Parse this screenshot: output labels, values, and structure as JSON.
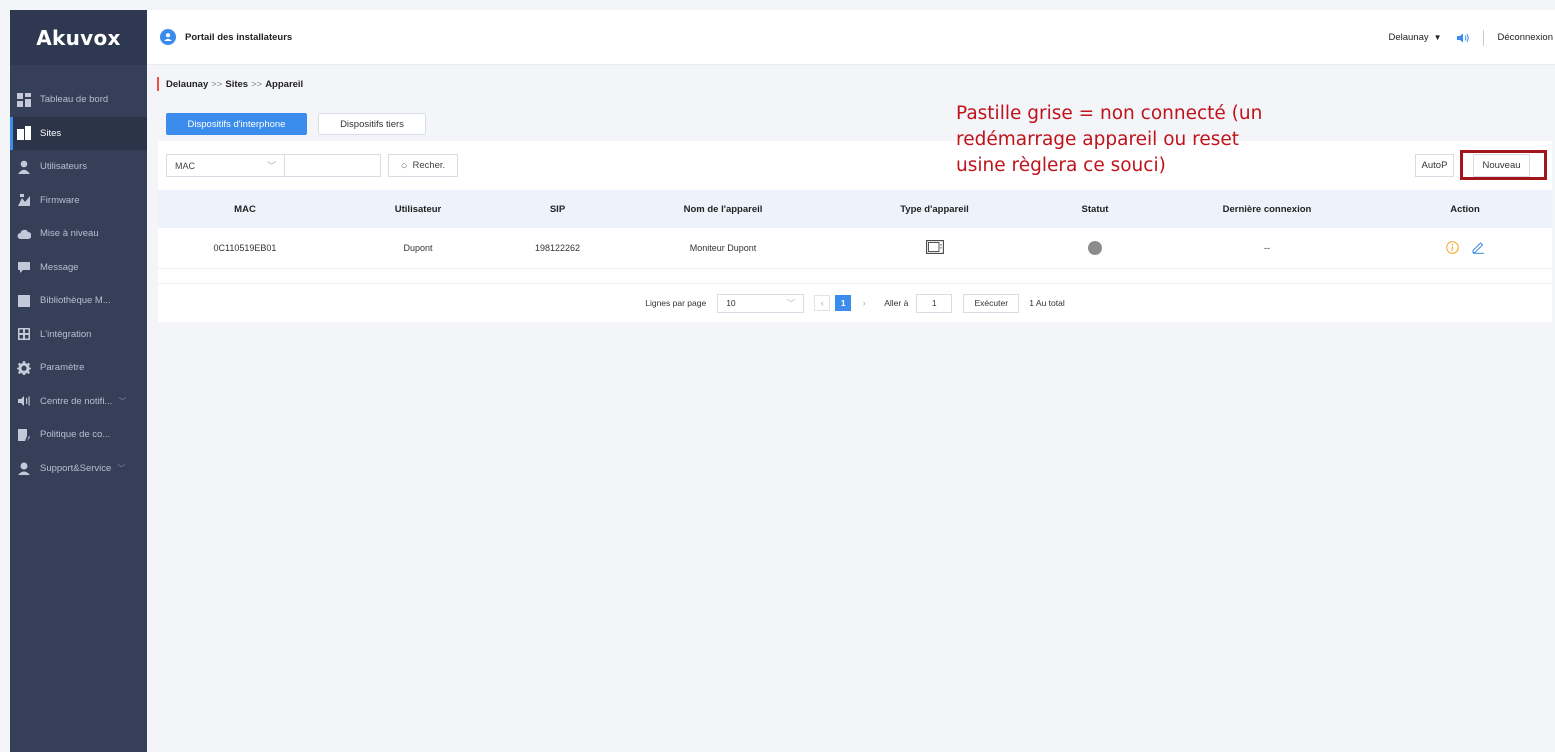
{
  "sidebar": {
    "logo": "Akuvox",
    "items": [
      {
        "label": "Tableau de bord",
        "icon": "dashboard-icon",
        "active": false,
        "chevron": false
      },
      {
        "label": "Sites",
        "icon": "building-icon",
        "active": true,
        "chevron": false
      },
      {
        "label": "Utilisateurs",
        "icon": "user-icon",
        "active": false,
        "chevron": false
      },
      {
        "label": "Firmware",
        "icon": "firmware-icon",
        "active": false,
        "chevron": false
      },
      {
        "label": "Mise à niveau",
        "icon": "cloud-upload-icon",
        "active": false,
        "chevron": false
      },
      {
        "label": "Message",
        "icon": "message-icon",
        "active": false,
        "chevron": false
      },
      {
        "label": "Bibliothèque M...",
        "icon": "library-icon",
        "active": false,
        "chevron": false
      },
      {
        "label": "L'intégration",
        "icon": "integration-icon",
        "active": false,
        "chevron": false
      },
      {
        "label": "Paramètre",
        "icon": "gear-icon",
        "active": false,
        "chevron": false
      },
      {
        "label": "Centre de notifi...",
        "icon": "speaker-icon",
        "active": false,
        "chevron": true
      },
      {
        "label": "Politique de co...",
        "icon": "policy-icon",
        "active": false,
        "chevron": false
      },
      {
        "label": "Support&Service",
        "icon": "support-icon",
        "active": false,
        "chevron": true
      }
    ]
  },
  "header": {
    "portal_title": "Portail des installateurs",
    "username": "Delaunay",
    "logout": "Déconnexion"
  },
  "breadcrumb": {
    "first": "Delaunay",
    "sep1": ">>",
    "second": "Sites",
    "sep2": ">>",
    "third": "Appareil"
  },
  "tabs": {
    "intercom": "Dispositifs d'interphone",
    "third_party": "Dispositifs tiers"
  },
  "search": {
    "field": "MAC",
    "value": "",
    "button": "Recher."
  },
  "actions": {
    "autop": "AutoP",
    "new": "Nouveau"
  },
  "table": {
    "headers": [
      "MAC",
      "Utilisateur",
      "SIP",
      "Nom de l'appareil",
      "Type d'appareil",
      "Statut",
      "Dernière connexion",
      "Action"
    ],
    "rows": [
      {
        "mac": "0C110519EB01",
        "user": "Dupont",
        "sip": "198122262",
        "name": "Moniteur Dupont",
        "type_icon": "monitor-icon",
        "status": "offline",
        "status_color": "#8c8c8c",
        "last_connection": "--"
      }
    ]
  },
  "pagination": {
    "rows_per_page_label": "Lignes par page",
    "rows_per_page": "10",
    "current_page": "1",
    "goto_label": "Aller à",
    "goto_value": "1",
    "execute": "Exécuter",
    "total": "1 Au total"
  },
  "annotation": {
    "lines": [
      "Pastille grise = non connecté (un",
      "redémarrage appareil ou reset",
      "usine règlera ce souci)"
    ],
    "color": "#c0121a"
  },
  "colors": {
    "accent": "#3b8cec",
    "sidebar": "#353f58",
    "breadcrumb_marker": "#e8504a",
    "info": "#f5a623"
  }
}
